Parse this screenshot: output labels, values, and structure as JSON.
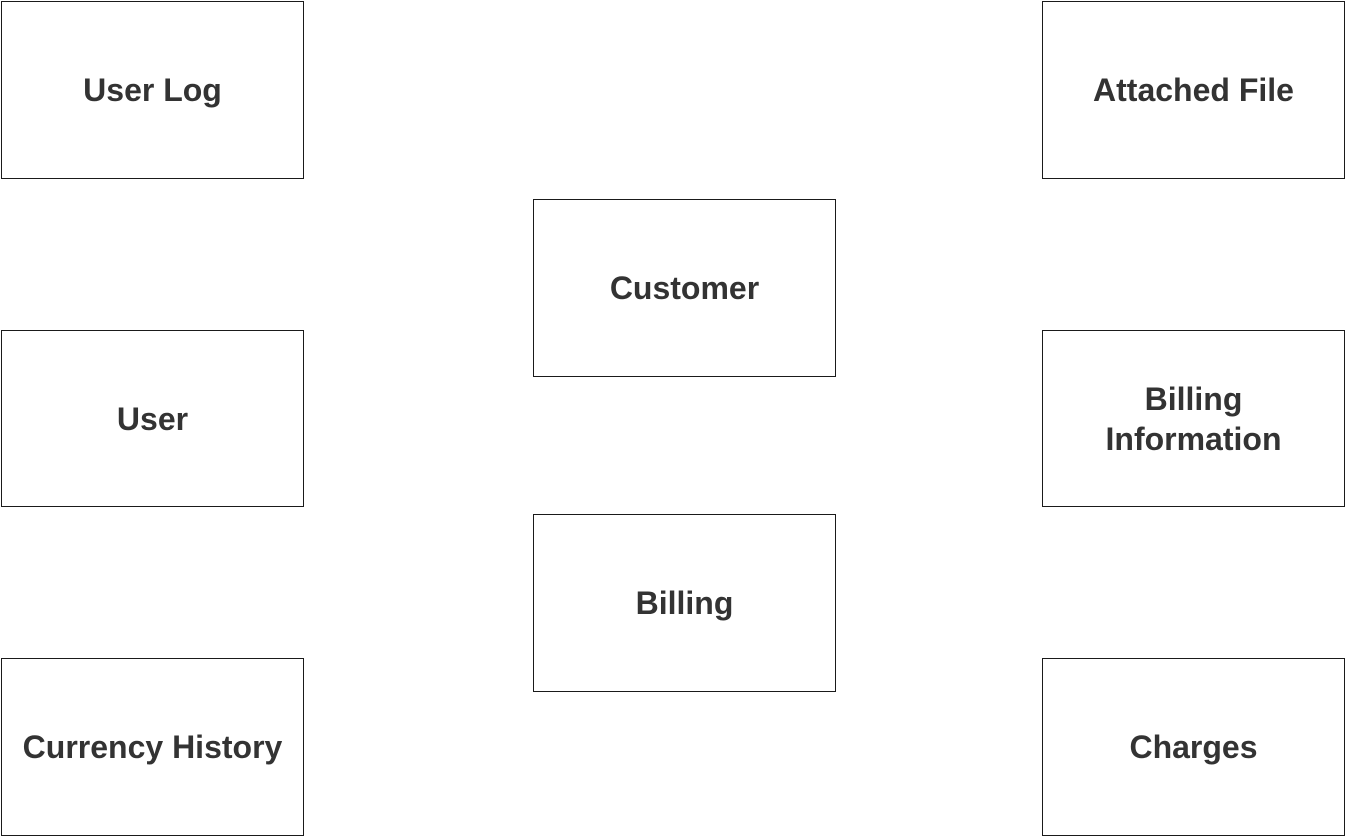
{
  "diagram": {
    "entities": [
      {
        "id": "user-log",
        "label": "User Log"
      },
      {
        "id": "user",
        "label": "User"
      },
      {
        "id": "currency-history",
        "label": "Currency History"
      },
      {
        "id": "customer",
        "label": "Customer"
      },
      {
        "id": "billing",
        "label": "Billing"
      },
      {
        "id": "attached-file",
        "label": "Attached File"
      },
      {
        "id": "billing-information",
        "label": "Billing Information"
      },
      {
        "id": "charges",
        "label": "Charges"
      }
    ]
  }
}
